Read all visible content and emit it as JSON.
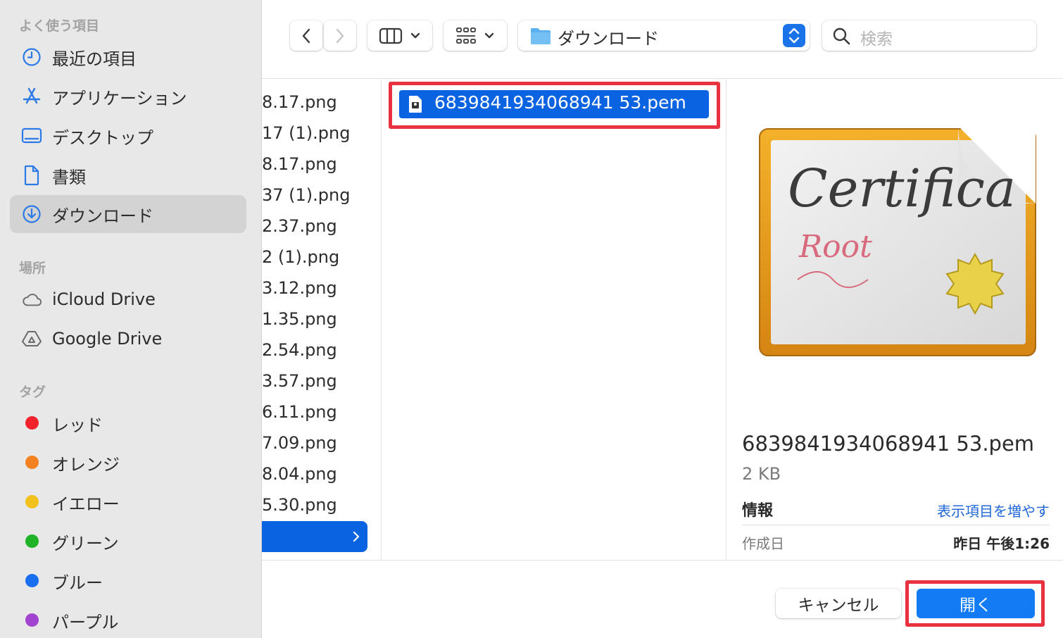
{
  "sidebar": {
    "favorites_title": "よく使う項目",
    "favorites": [
      {
        "label": "最近の項目",
        "icon": "clock-icon"
      },
      {
        "label": "アプリケーション",
        "icon": "app-store-icon"
      },
      {
        "label": "デスクトップ",
        "icon": "desktop-icon"
      },
      {
        "label": "書類",
        "icon": "document-icon"
      },
      {
        "label": "ダウンロード",
        "icon": "download-icon",
        "selected": true
      }
    ],
    "locations_title": "場所",
    "locations": [
      {
        "label": "iCloud Drive",
        "icon": "cloud-icon"
      },
      {
        "label": "Google Drive",
        "icon": "google-drive-icon"
      }
    ],
    "tags_title": "タグ",
    "tags": [
      {
        "label": "レッド",
        "color": "#f2222b"
      },
      {
        "label": "オレンジ",
        "color": "#f4811f"
      },
      {
        "label": "イエロー",
        "color": "#f3c11c"
      },
      {
        "label": "グリーン",
        "color": "#21b327"
      },
      {
        "label": "ブルー",
        "color": "#1a6ff1"
      },
      {
        "label": "パープル",
        "color": "#a344d0"
      }
    ]
  },
  "toolbar": {
    "path_label": "ダウンロード",
    "search_placeholder": "検索"
  },
  "column1": {
    "files": [
      "8.17.png",
      "17 (1).png",
      "8.17.png",
      "37 (1).png",
      "2.37.png",
      "2 (1).png",
      "3.12.png",
      "1.35.png",
      "2.54.png",
      "3.57.png",
      "6.11.png",
      "7.09.png",
      "8.04.png",
      "5.30.png"
    ]
  },
  "column2": {
    "selected_file": "6839841934068941 53.pem"
  },
  "preview": {
    "name": "6839841934068941 53.pem",
    "size": "2 KB",
    "info_title": "情報",
    "more_link": "表示項目を増やす",
    "created_label": "作成日",
    "created_value": "昨日 午後1:26"
  },
  "buttons": {
    "cancel": "キャンセル",
    "open": "開く"
  },
  "colors": {
    "accent": "#0a63e0",
    "highlight": "#e8323f",
    "link": "#1f67d8"
  }
}
